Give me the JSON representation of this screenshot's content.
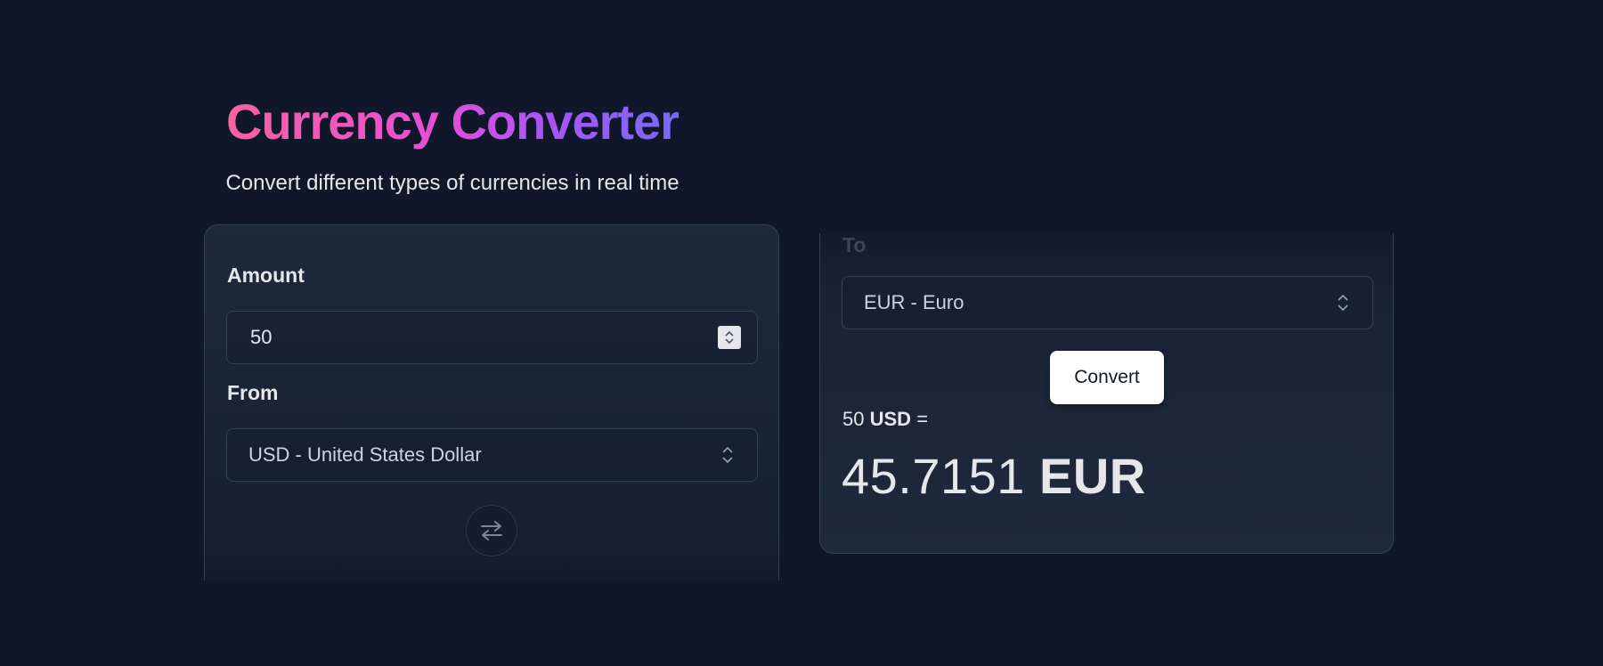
{
  "header": {
    "title": "Currency Converter",
    "subtitle": "Convert different types of currencies in real time"
  },
  "form": {
    "amount_label": "Amount",
    "amount_value": "50",
    "from_label": "From",
    "from_value": "USD - United States Dollar",
    "to_label": "To",
    "to_value": "EUR - Euro",
    "swap_icon": "swap-arrows-icon",
    "convert_label": "Convert"
  },
  "result": {
    "amount": "50",
    "from_code": "USD",
    "equals": "=",
    "converted_value": "45.7151",
    "to_code": "EUR"
  },
  "colors": {
    "background": "#11172a",
    "card": "#1e293b",
    "title_gradient_start": "#f8669a",
    "title_gradient_mid": "#e74fd4",
    "title_gradient_end": "#6d6ff2"
  }
}
